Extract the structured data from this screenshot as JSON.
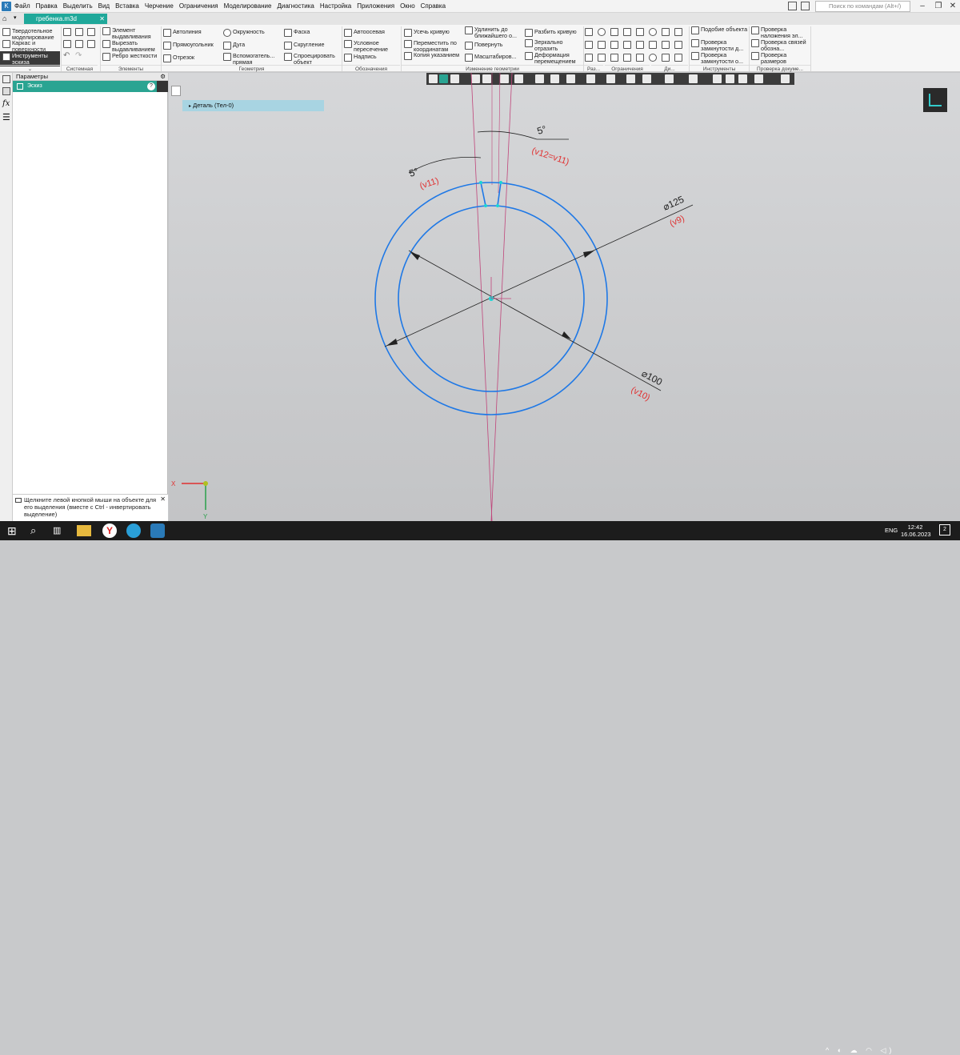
{
  "menubar": {
    "items": [
      "Файл",
      "Правка",
      "Выделить",
      "Вид",
      "Вставка",
      "Черчение",
      "Ограничения",
      "Моделирование",
      "Диагностика",
      "Настройка",
      "Приложения",
      "Окно",
      "Справка"
    ],
    "search_placeholder": "Поиск по командам (Alt+/)"
  },
  "tab": {
    "title": "гребенка.m3d"
  },
  "ribbon": {
    "modes": [
      "Твердотельное моделирование",
      "Каркас и поверхности",
      "Инструменты эскиза"
    ],
    "elements": [
      "Элемент выдавливания",
      "Вырезать выдавливанием",
      "Ребро жесткости"
    ],
    "geometry": [
      "Автолиния",
      "Прямоугольник",
      "Отрезок",
      "Окружность",
      "Дуга",
      "Вспомогатель... прямая",
      "Фаска",
      "Скругление",
      "Спроецировать объект"
    ],
    "annotations": [
      "Автоосевая",
      "Условное пересечение",
      "Надпись"
    ],
    "edit": [
      "Усечь кривую",
      "Переместить по координатам",
      "Копия указанием",
      "Удлинить до ближайшего о...",
      "Повернуть",
      "Масштабиров...",
      "Разбить кривую",
      "Зеркально отразить",
      "Деформация перемещением"
    ],
    "tools": [
      "Подобие объекта",
      "Проверка замкнутости д...",
      "Проверка замкнутости о..."
    ],
    "checks": [
      "Проверка наложения эл...",
      "Проверка связей обозна...",
      "Проверка размеров"
    ],
    "groups": [
      "Системная",
      "Элементы",
      "Геометрия",
      "Обозначения",
      "Изменение геометрии",
      "Раз...",
      "Ограничения",
      "Ди...",
      "Инструменты",
      "Проверка докуме..."
    ]
  },
  "panel": {
    "title": "Параметры",
    "row": "Эскиз"
  },
  "hint": {
    "text": "Щелкните левой кнопкой мыши на объекте для его выделения (вместе с Ctrl - инвертировать выделение)"
  },
  "tree": {
    "node": "Деталь (Тел-0)"
  },
  "drawing": {
    "dim_angle_top": "5°",
    "dim_angle_top_var": "(v12=v11)",
    "dim_angle_left": "5°",
    "dim_angle_left_var": "(v11)",
    "dim_d125": "⌀125",
    "dim_d125_var": "(v9)",
    "dim_d100": "⌀100",
    "dim_d100_var": "(v10)",
    "axis_x": "X",
    "axis_y": "Y"
  },
  "taskbar": {
    "lang": "ENG",
    "time": "12:42",
    "date": "16.06.2023",
    "notif": "2"
  },
  "colors": {
    "accent": "#1fa89a",
    "sketch_blue": "#1e78e6",
    "dim_red": "#e03030",
    "construction": "#c0457a"
  }
}
